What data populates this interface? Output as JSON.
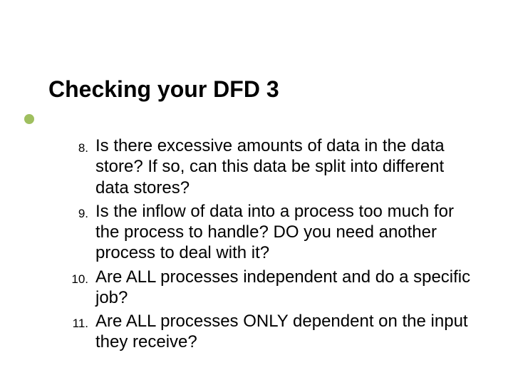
{
  "title": "Checking your DFD 3",
  "list": {
    "items": [
      {
        "num": "8.",
        "text": "Is there excessive amounts of data in the data store? If so, can this data be split into different data stores?"
      },
      {
        "num": "9.",
        "text": "Is the inflow of data into a process too much for the process to handle? DO you need another process to deal with it?"
      },
      {
        "num": "10.",
        "text": "Are ALL processes independent and do a specific job?"
      },
      {
        "num": "11.",
        "text": "Are ALL processes ONLY dependent on the input they receive?"
      }
    ]
  }
}
